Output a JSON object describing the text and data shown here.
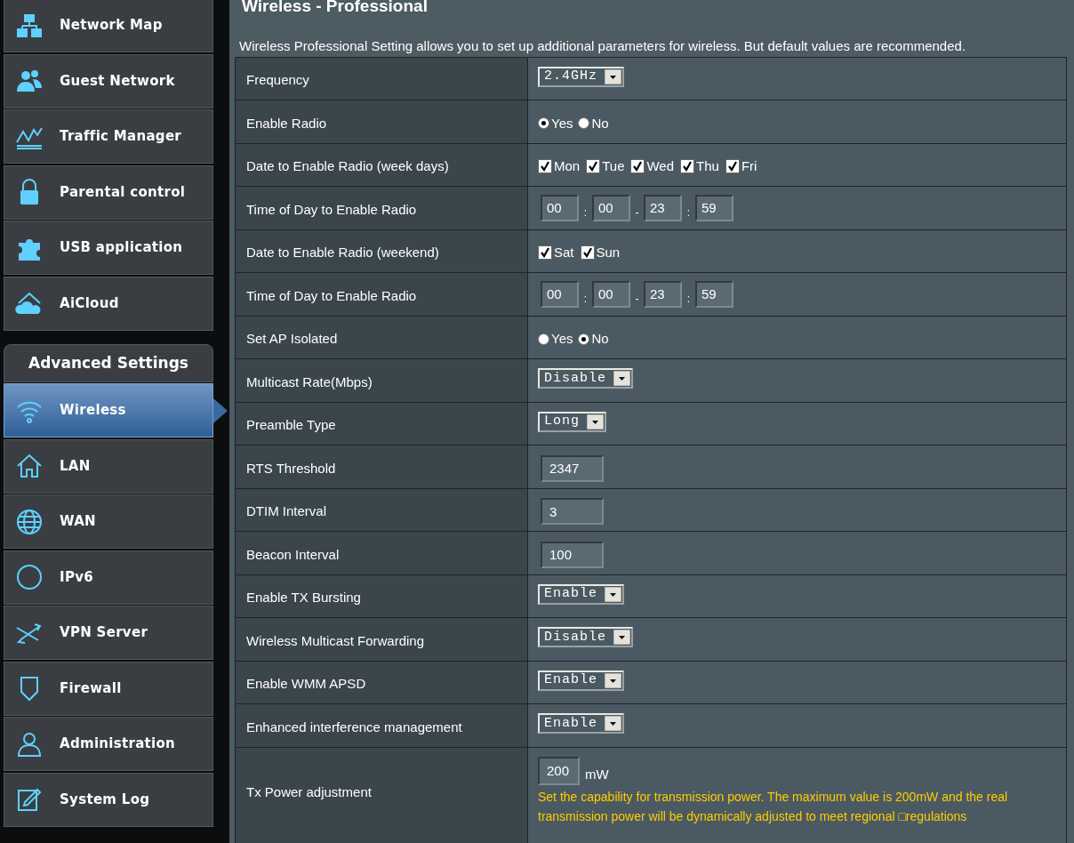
{
  "page": {
    "title": "Wireless - Professional",
    "description": "Wireless Professional Setting allows you to set up additional parameters for wireless. But default values are recommended."
  },
  "sidebar": {
    "general_items": [
      {
        "label": "Network Map",
        "selected": false
      },
      {
        "label": "Guest Network",
        "selected": false
      },
      {
        "label": "Traffic Manager",
        "selected": false
      },
      {
        "label": "Parental control",
        "selected": false
      },
      {
        "label": "USB application",
        "selected": false
      },
      {
        "label": "AiCloud",
        "selected": false
      }
    ],
    "advanced_header": "Advanced Settings",
    "advanced_items": [
      {
        "label": "Wireless",
        "selected": true
      },
      {
        "label": "LAN",
        "selected": false
      },
      {
        "label": "WAN",
        "selected": false
      },
      {
        "label": "IPv6",
        "selected": false
      },
      {
        "label": "VPN Server",
        "selected": false
      },
      {
        "label": "Firewall",
        "selected": false
      },
      {
        "label": "Administration",
        "selected": false
      },
      {
        "label": "System Log",
        "selected": false
      }
    ]
  },
  "settings": [
    {
      "label": "Frequency",
      "kind": "select",
      "value": "2.4GHz"
    },
    {
      "label": "Enable Radio",
      "kind": "radio",
      "options": [
        {
          "label": "Yes",
          "selected": true
        },
        {
          "label": "No",
          "selected": false
        }
      ]
    },
    {
      "label": "Date to Enable Radio (week days)",
      "kind": "checkboxes",
      "options": [
        {
          "label": "Mon",
          "checked": true
        },
        {
          "label": "Tue",
          "checked": true
        },
        {
          "label": "Wed",
          "checked": true
        },
        {
          "label": "Thu",
          "checked": true
        },
        {
          "label": "Fri",
          "checked": true
        }
      ]
    },
    {
      "label": "Time of Day to Enable Radio",
      "kind": "time",
      "fields": [
        "00",
        "00",
        "23",
        "59"
      ],
      "separators": [
        ":",
        "-",
        ":"
      ]
    },
    {
      "label": "Date to Enable Radio (weekend)",
      "kind": "checkboxes",
      "options": [
        {
          "label": "Sat",
          "checked": true
        },
        {
          "label": "Sun",
          "checked": true
        }
      ]
    },
    {
      "label": "Time of Day to Enable Radio",
      "kind": "time",
      "fields": [
        "00",
        "00",
        "23",
        "59"
      ],
      "separators": [
        ":",
        "-",
        ":"
      ]
    },
    {
      "label": "Set AP Isolated",
      "kind": "radio",
      "options": [
        {
          "label": "Yes",
          "selected": false
        },
        {
          "label": "No",
          "selected": true
        }
      ]
    },
    {
      "label": "Multicast Rate(Mbps)",
      "kind": "select",
      "value": "Disable"
    },
    {
      "label": "Preamble Type",
      "kind": "select",
      "value": "Long"
    },
    {
      "label": "RTS Threshold",
      "kind": "text",
      "value": "2347"
    },
    {
      "label": "DTIM Interval",
      "kind": "text",
      "value": "3"
    },
    {
      "label": "Beacon Interval",
      "kind": "text",
      "value": "100"
    },
    {
      "label": "Enable TX Bursting",
      "kind": "select",
      "value": "Enable"
    },
    {
      "label": "Wireless Multicast Forwarding",
      "kind": "select",
      "value": "Disable"
    },
    {
      "label": "Enable WMM APSD",
      "kind": "select",
      "value": "Enable"
    },
    {
      "label": "Enhanced interference management",
      "kind": "select",
      "value": "Enable"
    },
    {
      "label": "Tx Power adjustment",
      "kind": "power",
      "value": "200",
      "unit": "mW",
      "note": "Set the capability for transmission power. The maximum value is 200mW and the real transmission power will be dynamically adjusted to meet regional □regulations"
    }
  ]
}
